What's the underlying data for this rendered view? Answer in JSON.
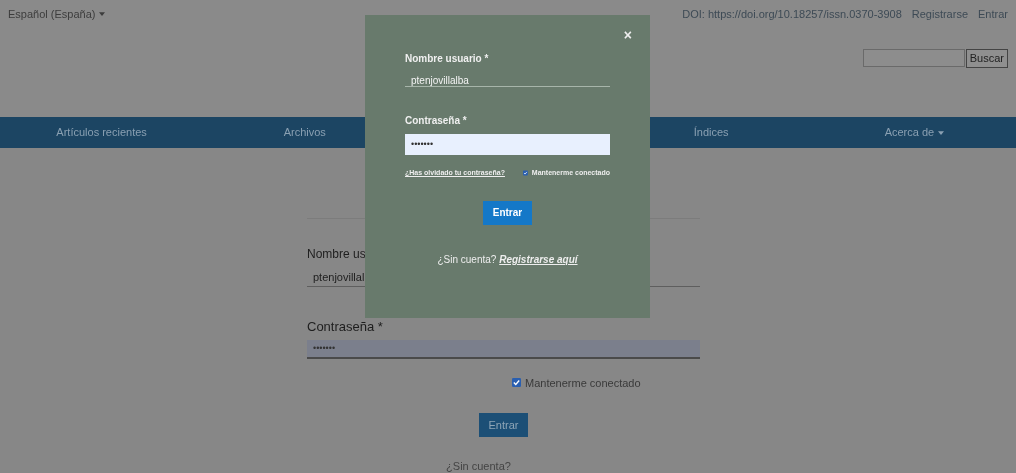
{
  "top_bar": {
    "language": "Español (España)",
    "doi": "DOI: https://doi.org/10.18257/issn.0370-3908",
    "links": [
      "Registrarse",
      "Entrar"
    ]
  },
  "search": {
    "button": "Buscar"
  },
  "nav": [
    {
      "label": "Artículos recientes",
      "dropdown": false
    },
    {
      "label": "Archivos",
      "dropdown": false
    },
    {
      "label": "Índices",
      "dropdown": false
    },
    {
      "label": "Acerca de",
      "dropdown": true
    }
  ],
  "page_form": {
    "username_label": "Nombre us",
    "username_value": "ptenjovillal",
    "password_label": "Contraseña *",
    "password_value": "•••••••",
    "remember": {
      "label": "Mantenerme conectado",
      "checked": true
    },
    "submit": "Entrar",
    "no_account": "¿Sin cuenta?"
  },
  "modal": {
    "close": "×",
    "username_label": "Nombre usuario *",
    "username_value": "ptenjovillalba",
    "password_label": "Contraseña *",
    "password_value": "•••••••",
    "forgot_link": "¿Has olvidado tu contraseña?",
    "remember": {
      "label": "Mantenerme conectado",
      "checked": true
    },
    "submit": "Entrar",
    "no_account": "¿Sin cuenta?",
    "register_link": "Registrarse aquí"
  }
}
